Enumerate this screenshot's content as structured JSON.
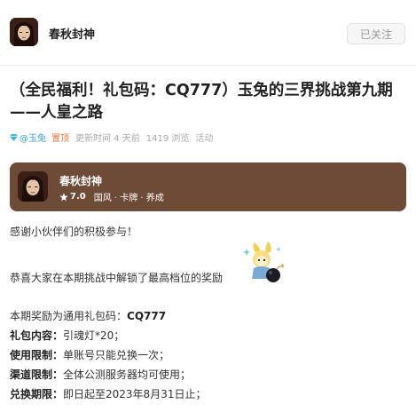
{
  "header": {
    "game_name": "春秋封神",
    "follow_label": "已关注"
  },
  "post": {
    "title": "（全民福利！礼包码：CQ777）玉兔的三界挑战第九期——人皇之路",
    "meta": {
      "author": "@玉兔",
      "pinned": "置顶",
      "updated": "更新时间 4 天前",
      "views": "1419 浏览",
      "category": "活动"
    }
  },
  "game_card": {
    "name": "春秋封神",
    "rating": "7.0",
    "tags": "国风 · 卡牌 · 养成"
  },
  "body": {
    "thanks": "感谢小伙伴们的积极参与！",
    "congrats": "恭喜大家在本期挑战中解锁了最高档位的奖励",
    "code_intro": "本期奖励为通用礼包码：",
    "code": "CQ777",
    "details": [
      {
        "label": "礼包内容：",
        "value": "引魂灯*20；"
      },
      {
        "label": "使用限制：",
        "value": "单账号只能兑换一次；"
      },
      {
        "label": "渠道限制：",
        "value": "全体公测服务器均可使用；"
      },
      {
        "label": "兑换期限：",
        "value": "即日起至2023年8月31日止；"
      }
    ]
  },
  "colors": {
    "card_bg": "#6e4b37",
    "author": "#36a1d9",
    "pinned": "#f06e36"
  }
}
